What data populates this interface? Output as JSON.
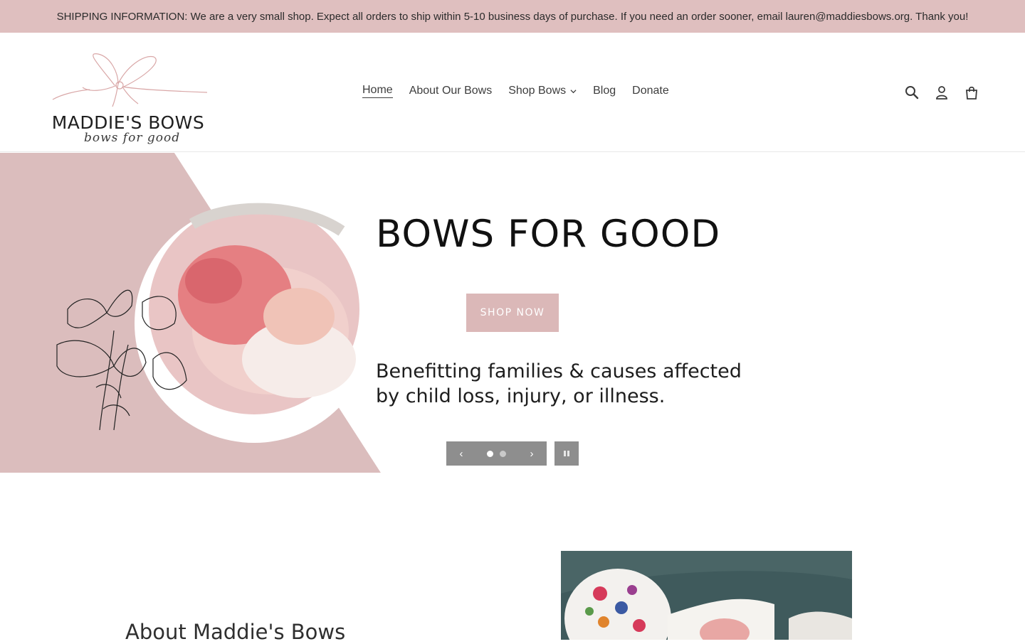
{
  "announcement": {
    "text": "SHIPPING INFORMATION: We are a very small shop. Expect all orders to ship within 5-10 business days of purchase. If you need an order sooner, email lauren@maddiesbows.org. Thank you!"
  },
  "logo": {
    "brand": "MADDIE'S BOWS",
    "tagline": "bows for good"
  },
  "nav": {
    "items": [
      {
        "label": "Home",
        "active": true
      },
      {
        "label": "About Our Bows"
      },
      {
        "label": "Shop Bows",
        "has_dropdown": true
      },
      {
        "label": "Blog"
      },
      {
        "label": "Donate"
      }
    ]
  },
  "header_icons": [
    "search-icon",
    "account-icon",
    "cart-icon"
  ],
  "hero": {
    "title": "BOWS FOR GOOD",
    "button": "SHOP NOW",
    "subtitle": "Benefitting families & causes affected by child loss, injury, or illness.",
    "slides_total": 2,
    "current_slide": 1
  },
  "about": {
    "title": "About Maddie's Bows"
  },
  "colors": {
    "announcement_bg": "#dfbfbf",
    "hero_pink": "#dbbdbd",
    "button_bg": "#dbb8b8",
    "slider_ctrl_bg": "#8e8e8e"
  }
}
